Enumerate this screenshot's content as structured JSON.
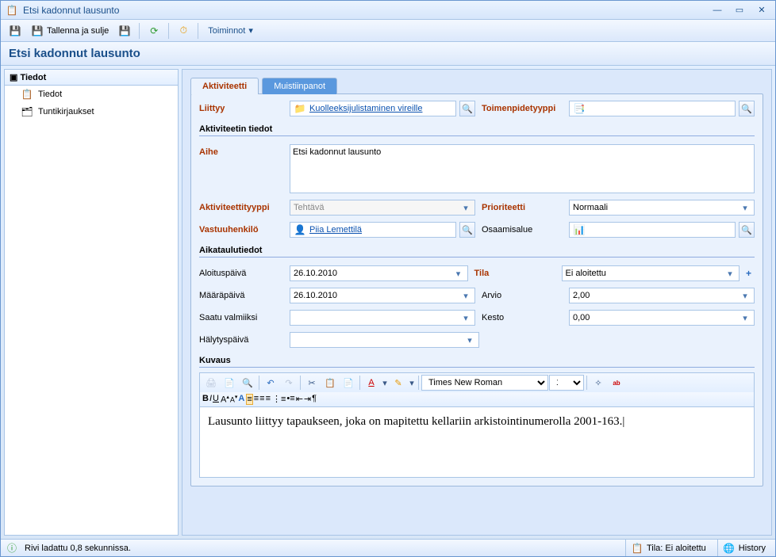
{
  "window": {
    "title": "Etsi kadonnut lausunto"
  },
  "toolbar": {
    "save_close": "Tallenna ja sulje",
    "actions": "Toiminnot"
  },
  "section_title": "Etsi kadonnut lausunto",
  "sidebar": {
    "header": "Tiedot",
    "items": [
      {
        "label": "Tiedot"
      },
      {
        "label": "Tuntikirjaukset"
      }
    ]
  },
  "tabs": {
    "active": "Aktiviteetti",
    "notes": "Muistiinpanot"
  },
  "form": {
    "liittyy": {
      "label": "Liittyy",
      "value": "Kuolleeksijulistaminen vireille"
    },
    "toimenpidetyyppi": {
      "label": "Toimenpidetyyppi",
      "value": ""
    },
    "aktiviteetin_tiedot": "Aktiviteetin tiedot",
    "aihe": {
      "label": "Aihe",
      "value": "Etsi kadonnut lausunto"
    },
    "aktiviteettityyppi": {
      "label": "Aktiviteettityyppi",
      "value": "Tehtävä"
    },
    "prioriteetti": {
      "label": "Prioriteetti",
      "value": "Normaali"
    },
    "vastuuhenkilo": {
      "label": "Vastuuhenkilö",
      "value": "Piia Lemettilä"
    },
    "osaamisalue": {
      "label": "Osaamisalue",
      "value": ""
    },
    "aikataulutiedot": "Aikataulutiedot",
    "aloituspaiva": {
      "label": "Aloituspäivä",
      "value": "26.10.2010"
    },
    "tila": {
      "label": "Tila",
      "value": "Ei aloitettu"
    },
    "maarapaiva": {
      "label": "Määräpäivä",
      "value": "26.10.2010"
    },
    "arvio": {
      "label": "Arvio",
      "value": "2,00"
    },
    "saatu_valmiiksi": {
      "label": "Saatu valmiiksi",
      "value": ""
    },
    "kesto": {
      "label": "Kesto",
      "value": "0,00"
    },
    "halytyspaiva": {
      "label": "Hälytyspäivä",
      "value": ""
    },
    "kuvaus": "Kuvaus",
    "rte_font": "Times New Roman",
    "rte_size": "12",
    "rte_text": "Lausunto liittyy tapaukseen, joka on mapitettu kellariin arkistointinumerolla 2001-163."
  },
  "status": {
    "left": "Rivi ladattu 0,8 sekunnissa.",
    "tila": "Tila: Ei aloitettu",
    "history": "History"
  }
}
